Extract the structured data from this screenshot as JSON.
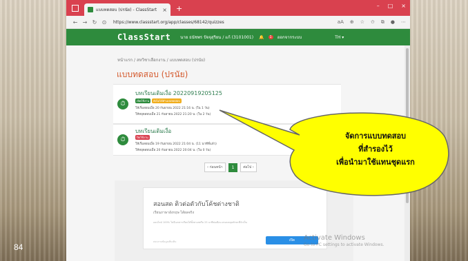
{
  "slide": {
    "number": "84"
  },
  "browser": {
    "tab_title": "แบบทดสอบ (ปรนัย) - ClassStart",
    "tab_close": "×",
    "new_tab": "+",
    "url": "https://www.classstart.org/app/classes/68142/quizzes",
    "window_controls": {
      "minimize": "–",
      "maximize": "□",
      "close": "×"
    }
  },
  "app": {
    "logo": "ClassStart",
    "user": "นาย ธนัชพร ปัจจุสุริยน / แก้ (3101001)",
    "notification_count": "1",
    "logout": "ออกจากระบบ",
    "language": "TH ▾"
  },
  "breadcrumb": "หน้าแรก / สหวิชาเลือกงาน / แบบทดสอบ (ปรนัย)",
  "page_title": "แบบทดสอบ (ปรนัย)",
  "quizzes": [
    {
      "title": "บทเรียนเดิมเงื่อ 20220919205125",
      "badges": [
        {
          "label": "เปิดใช้งาน",
          "color": "#2e8b3d"
        },
        {
          "label": "ยังไม่ได้ทำแบบทดสอบ",
          "color": "#f0ad1c"
        }
      ],
      "line1": "ให้เริ่มสอบเมื่อ 20 กันยายน 2022 21:16 น. (ใน 1 วัน)",
      "line2": "ให้หยุดสอบเมื่อ 21 กันยายน 2022 21:20 น. (ใน 2 วัน)"
    },
    {
      "title": "บทเรียนเดิมเงื่อ",
      "badges": [
        {
          "label": "ปิดใช้งาน",
          "color": "#d9414f"
        }
      ],
      "line1": "ให้เริ่มสอบเมื่อ 19 กันยายน 2022 21:04 น. (11 นาทีที่แล้ว)",
      "line2": "ให้หยุดสอบเมื่อ 20 กันยายน 2022 20:04 น. (ใน 0 วัน)"
    }
  ],
  "pagination": {
    "prev": "‹ ก่อนหน้า",
    "current": "1",
    "next": "ต่อไป ›"
  },
  "promo": {
    "title": "สอนสด ติวต่อตัวกับโค้ชต่างชาติ",
    "subtitle": "เรียนภาษาอังกฤษ ได้ผลจริง",
    "description": "ออนไลน์ 100% ไม่มีเอกสารเรียนได้ทั้งทางสตรีม 25 นาทีต่อเดือน ครอบคลุมทักษะที่จำเป็น",
    "footer": "สอบถามข้อมูลเพิ่มเติม",
    "button": "เปิด"
  },
  "watermark": {
    "line1": "Activate Windows",
    "line2": "Go to PC settings to activate Windows."
  },
  "callout": {
    "lines": [
      "จัดการแบบทดสอบ",
      "ที่สำรองไว้",
      "เพื่อนำมาใช้แทนชุดแรก"
    ],
    "fill": "#ffff00",
    "stroke": "#666666"
  },
  "colors": {
    "tabbar": "#d9414f",
    "header": "#2e8b3d",
    "title_accent": "#d45a2e",
    "button_blue": "#2a8fe6"
  }
}
